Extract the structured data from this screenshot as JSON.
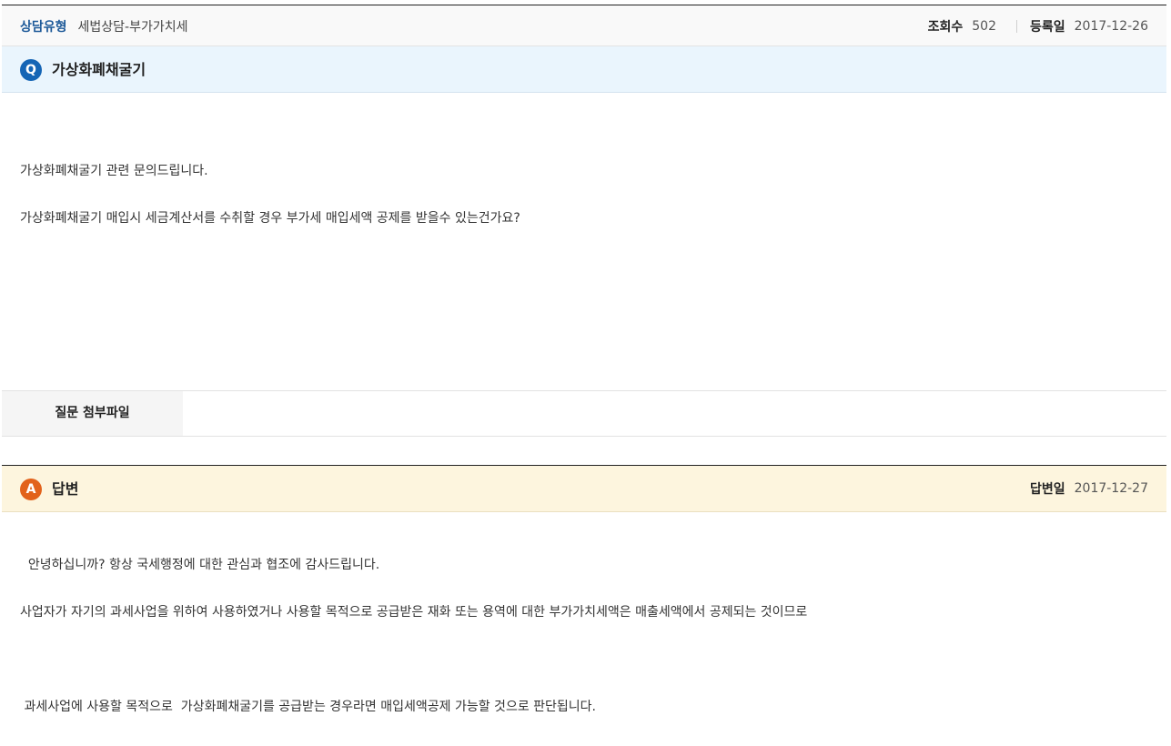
{
  "meta": {
    "type_label": "상담유형",
    "type_value": "세법상담-부가가치세",
    "views_label": "조회수",
    "views_value": "502",
    "date_label": "등록일",
    "date_value": "2017-12-26"
  },
  "question": {
    "badge": "Q",
    "title": "가상화폐채굴기",
    "body": [
      "가상화폐채굴기 관련 문의드립니다.",
      "가상화폐채굴기 매입시 세금계산서를 수취할 경우 부가세 매입세액 공제를 받을수 있는건가요?"
    ]
  },
  "attachment": {
    "label": "질문 첨부파일"
  },
  "answer": {
    "badge": "A",
    "title": "답변",
    "date_label": "답변일",
    "date_value": "2017-12-27",
    "lines": [
      "  안녕하십니까? 항상 국세행정에 대한 관심과 협조에 감사드립니다.",
      "사업자가 자기의 과세사업을 위하여 사용하였거나 사용할 목적으로 공급받은 재화 또는 용역에 대한 부가가치세액은 매출세액에서 공제되는 것이므로",
      " 과세사업에 사용할 목적으로  가상화폐채굴기를 공급받는 경우라면 매입세액공제 가능할 것으로 판단됩니다."
    ]
  },
  "colors": {
    "question_bar": "#eaf5fd",
    "answer_bar": "#fdf5de",
    "q_badge": "#1565b5",
    "a_badge": "#e2621b",
    "type_label": "#1e5a99"
  }
}
